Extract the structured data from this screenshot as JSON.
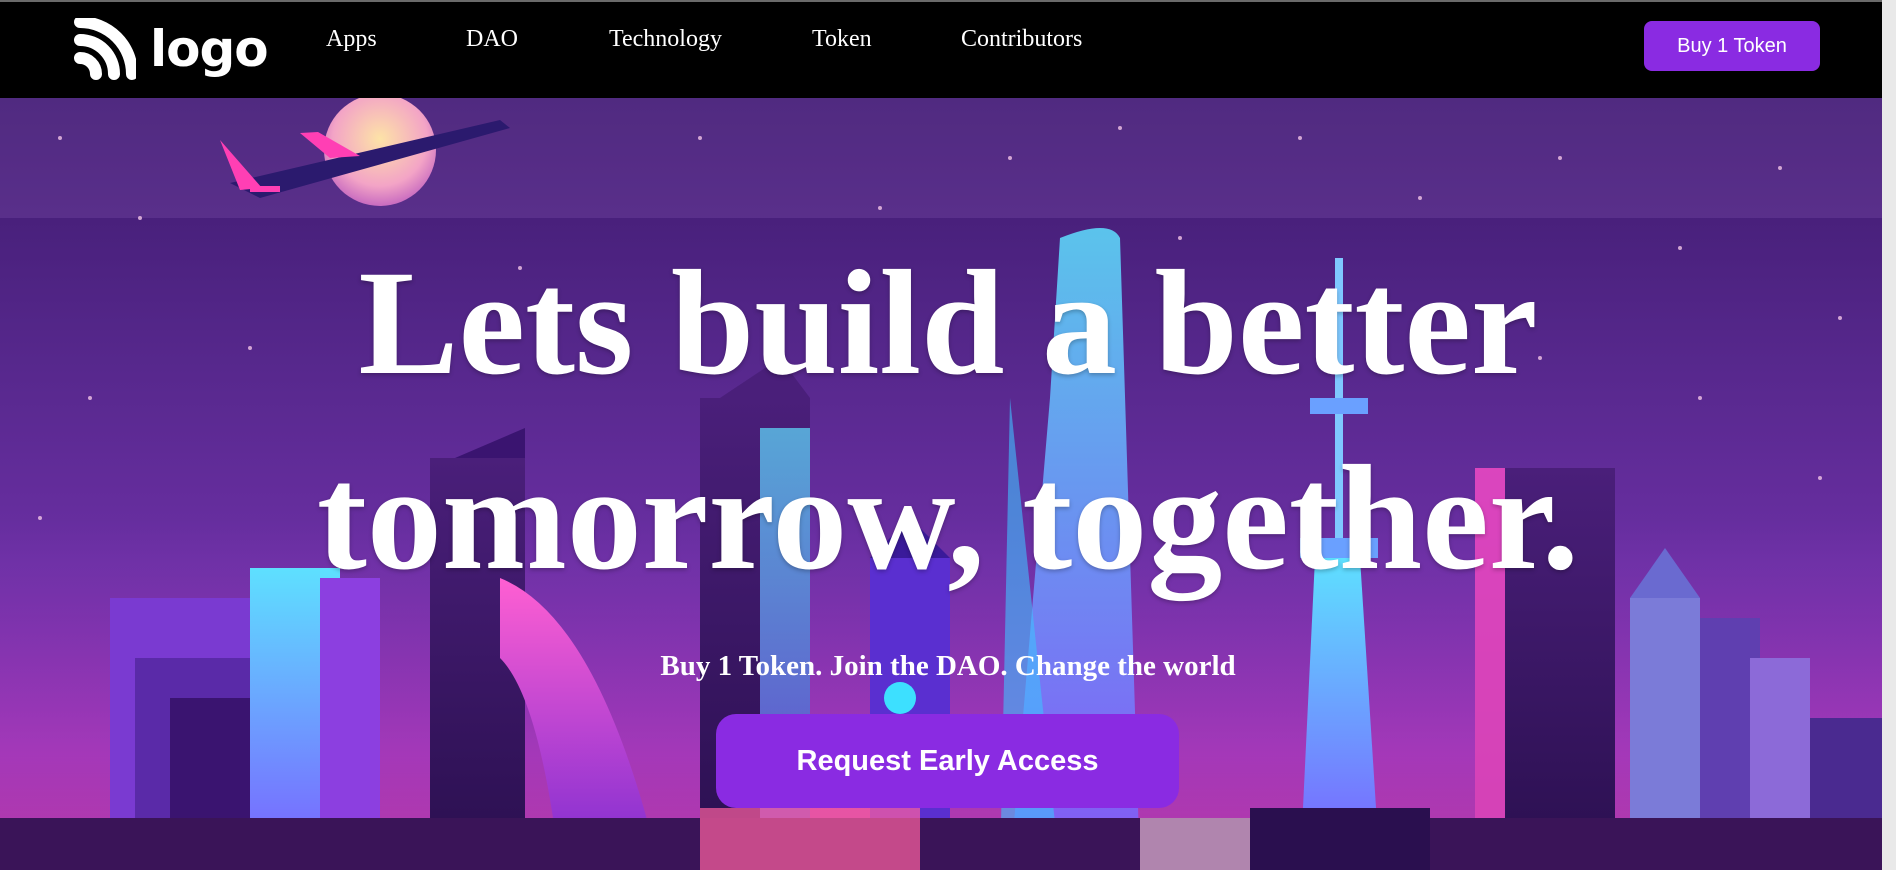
{
  "header": {
    "logo_text": "logo",
    "nav": [
      {
        "label": "Apps"
      },
      {
        "label": "DAO"
      },
      {
        "label": "Technology"
      },
      {
        "label": "Token"
      },
      {
        "label": "Contributors"
      }
    ],
    "buy_button": "Buy 1 Token"
  },
  "hero": {
    "headline_line1": "Lets build a better",
    "headline_line2": "tomorrow, together.",
    "subheadline": "Buy 1 Token. Join the DAO. Change the world",
    "cta_label": "Request Early Access"
  },
  "colors": {
    "accent": "#8a2be2",
    "nav_background": "#000000",
    "text": "#ffffff"
  },
  "icons": {
    "logo_mark": "signal-arcs-icon"
  }
}
